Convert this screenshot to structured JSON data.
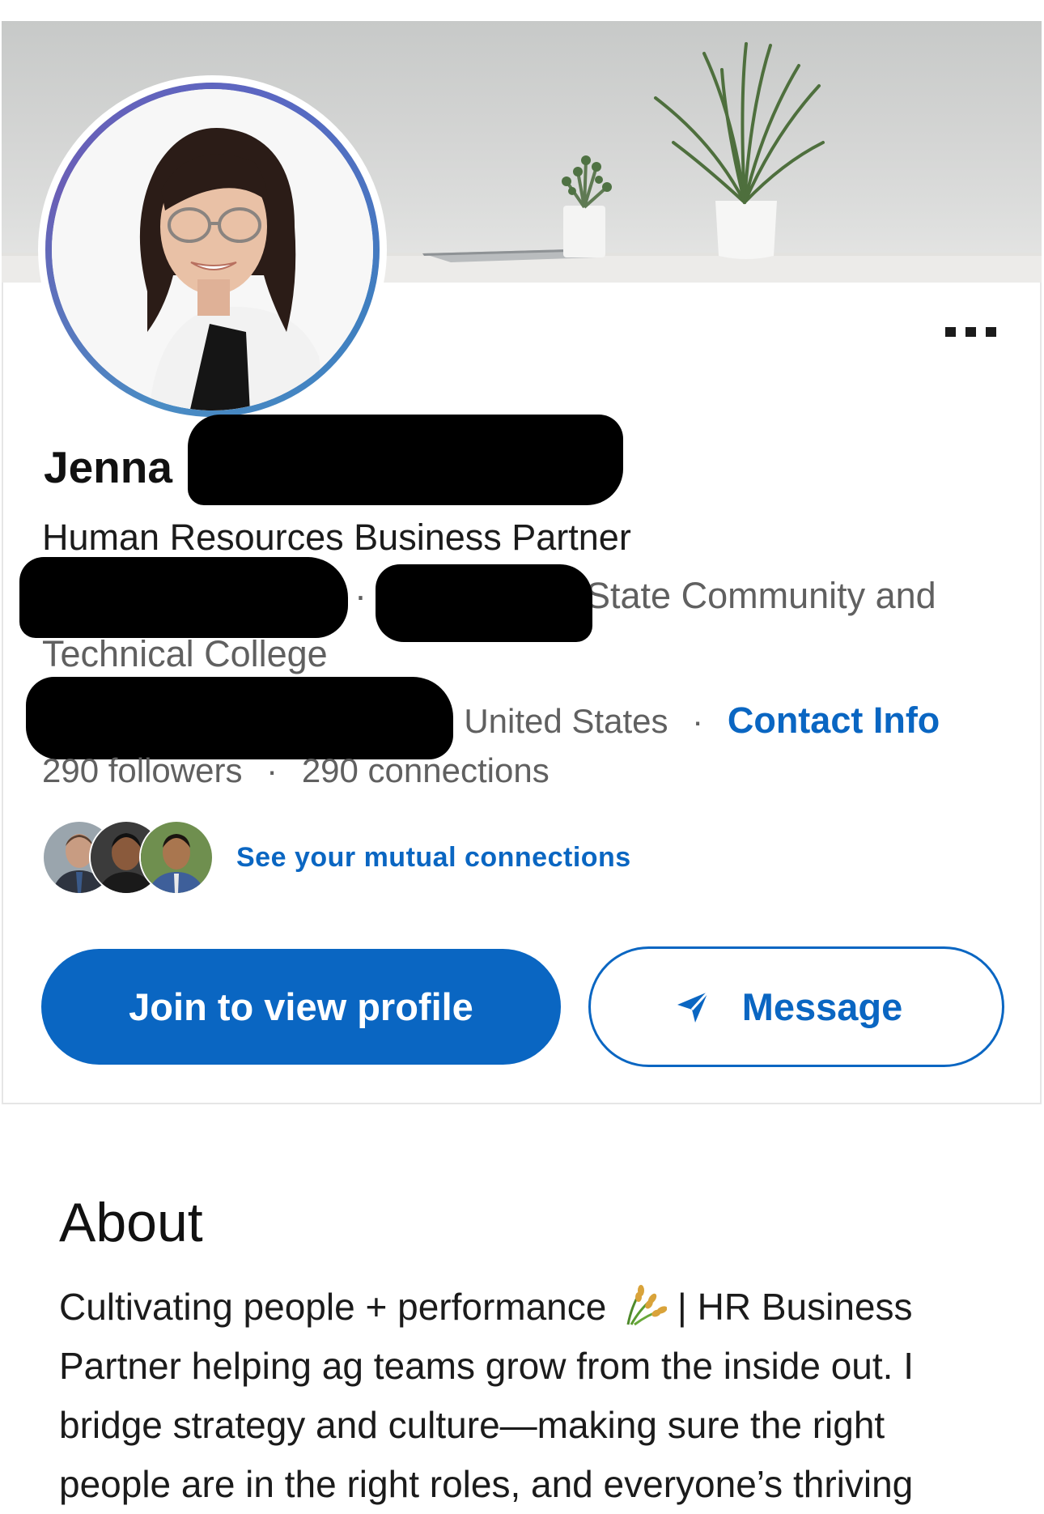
{
  "profile": {
    "first_name": "Jenna",
    "headline": "Human Resources Business Partner",
    "education_line1": "State Community and",
    "education_separator": "·",
    "education_line2": "Technical College",
    "location": ", United States",
    "location_separator": "·",
    "contact_info": "Contact Info",
    "followers": "290 followers",
    "stats_separator": "·",
    "connections": "290 connections",
    "mutual_connections": "See your mutual connections"
  },
  "actions": {
    "join_label": "Join to view profile",
    "message_label": "Message"
  },
  "about": {
    "title": "About",
    "line1_a": "Cultivating people + performance",
    "line1_b": "| HR Business",
    "line2": "Partner helping ag teams grow from the inside out. I",
    "line3": "bridge strategy and culture—making sure the right",
    "line4": "people are in the right roles, and everyone’s thriving"
  },
  "icons": {
    "more": "more-options-icon",
    "message": "send-icon",
    "about_emoji": "wheat-icon"
  },
  "colors": {
    "accent": "#0a66c2",
    "text_primary": "#1b1b1b",
    "text_secondary": "#606060"
  }
}
